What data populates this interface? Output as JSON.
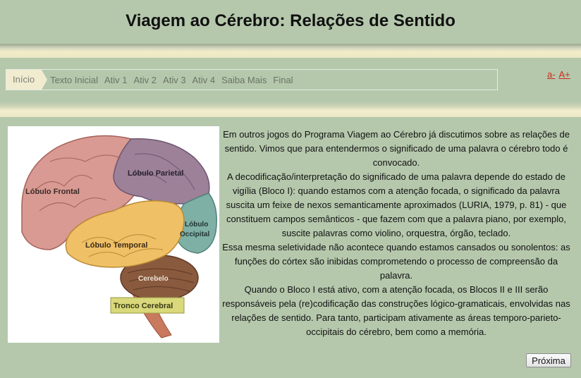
{
  "header": {
    "title": "Viagem ao Cérebro: Relações de Sentido"
  },
  "nav": {
    "tabs": [
      {
        "label": "Início",
        "active": true
      },
      {
        "label": "Texto Inicial",
        "active": false
      },
      {
        "label": "Ativ 1",
        "active": false
      },
      {
        "label": "Ativ 2",
        "active": false
      },
      {
        "label": "Ativ 3",
        "active": false
      },
      {
        "label": "Ativ 4",
        "active": false
      },
      {
        "label": "Saiba Mais",
        "active": false
      },
      {
        "label": "Final",
        "active": false
      }
    ]
  },
  "font_controls": {
    "decrease": "a-",
    "increase": "A+"
  },
  "figure": {
    "labels": {
      "frontal": "Lóbulo Frontal",
      "parietal": "Lóbulo Parietal",
      "occipital_1": "Lóbulo",
      "occipital_2": "Occipital",
      "temporal": "Lóbulo Temporal",
      "cerebelo": "Cerebelo",
      "tronco": "Tronco Cerebral"
    }
  },
  "content": {
    "paragraphs": [
      "Em outros jogos do Programa Viagem ao Cérebro já discutimos sobre as relações de sentido. Vimos que para entendermos o significado de uma palavra o cérebro todo é convocado.",
      "A decodificação/interpretação do significado de uma palavra depende do estado de vigília (Bloco I): quando estamos com a atenção focada, o significado da palavra suscita um feixe de nexos semanticamente aproximados (LURIA, 1979, p. 81) - que constituem campos semânticos - que fazem com que a palavra piano, por exemplo, suscite palavras como violino, orquestra, órgão, teclado.",
      "Essa mesma seletividade não acontece quando estamos cansados ou sonolentos: as funções do córtex são inibidas comprometendo o processo de compreensão da palavra.",
      "Quando o Bloco I está ativo, com a atenção focada, os Blocos II e III serão responsáveis pela (re)codificação das construções lógico-gramaticais, envolvidas nas relações de sentido. Para tanto, participam ativamente as áreas temporo-parieto-occipitais do cérebro, bem como a memória."
    ]
  },
  "actions": {
    "next_label": "Próxima"
  },
  "colors": {
    "background": "#b5c8ac",
    "active_tab": "#f1ecd0",
    "font_link": "#d02a1e"
  }
}
